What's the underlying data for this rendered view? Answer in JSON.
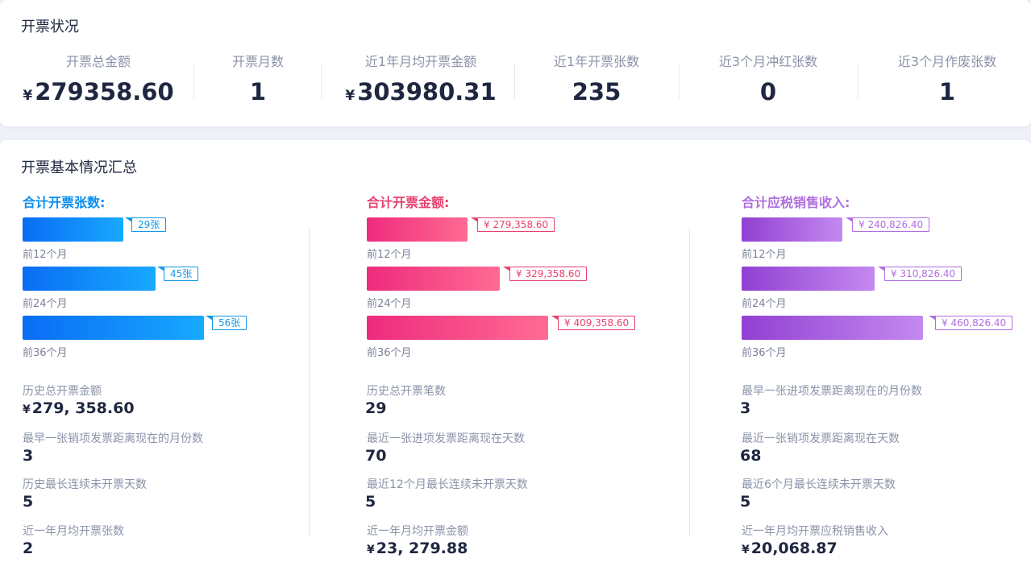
{
  "overview": {
    "title": "开票状况",
    "currency_symbol": "¥",
    "stats": [
      {
        "label": "开票总金额",
        "value": "279358.60",
        "currency": true
      },
      {
        "label": "开票月数",
        "value": "1",
        "currency": false
      },
      {
        "label": "近1年月均开票金额",
        "value": "303980.31",
        "currency": true
      },
      {
        "label": "近1年开票张数",
        "value": "235",
        "currency": false
      },
      {
        "label": "近3个月冲红张数",
        "value": "0",
        "currency": false
      },
      {
        "label": "近3个月作废张数",
        "value": "1",
        "currency": false
      }
    ]
  },
  "summary": {
    "title": "开票基本情况汇总",
    "columns": [
      {
        "heading": "合计开票张数:",
        "heading_color": "#0a8ef0",
        "bars": [
          {
            "period": "前12个月",
            "tag": "29张",
            "value": 29
          },
          {
            "period": "前24个月",
            "tag": "45张",
            "value": 45
          },
          {
            "period": "前36个月",
            "tag": "56张",
            "value": 56
          }
        ],
        "metrics": [
          {
            "label": "历史总开票金额",
            "value": "279, 358.60",
            "currency": true
          },
          {
            "label": "最早一张销项发票距离现在的月份数",
            "value": "3",
            "currency": false
          },
          {
            "label": "历史最长连续未开票天数",
            "value": "5",
            "currency": false
          },
          {
            "label": "近一年月均开票张数",
            "value": "2",
            "currency": false
          }
        ]
      },
      {
        "heading": "合计开票金额:",
        "heading_color": "#e8416f",
        "bars": [
          {
            "period": "前12个月",
            "tag": "¥ 279,358.60",
            "value": 279358.6
          },
          {
            "period": "前24个月",
            "tag": "¥ 329,358.60",
            "value": 329358.6
          },
          {
            "period": "前36个月",
            "tag": "¥ 409,358.60",
            "value": 409358.6
          }
        ],
        "metrics": [
          {
            "label": "历史总开票笔数",
            "value": "29",
            "currency": false
          },
          {
            "label": "最近一张进项发票距离现在天数",
            "value": "70",
            "currency": false
          },
          {
            "label": "最近12个月最长连续未开票天数",
            "value": "5",
            "currency": false
          },
          {
            "label": "近一年月均开票金额",
            "value": "23, 279.88",
            "currency": true
          }
        ]
      },
      {
        "heading": "合计应税销售收入:",
        "heading_color": "#b06ee0",
        "bars": [
          {
            "period": "前12个月",
            "tag": "¥ 240,826.40",
            "value": 240826.4
          },
          {
            "period": "前24个月",
            "tag": "¥ 310,826.40",
            "value": 310826.4
          },
          {
            "period": "前36个月",
            "tag": "¥ 460,826.40",
            "value": 460826.4
          }
        ],
        "metrics": [
          {
            "label": "最早一张进项发票距离现在的月份数",
            "value": "3",
            "currency": false
          },
          {
            "label": "最近一张销项发票距离现在天数",
            "value": "68",
            "currency": false
          },
          {
            "label": "最近6个月最长连续未开票天数",
            "value": "5",
            "currency": false
          },
          {
            "label": "近一年月均开票应税销售收入",
            "value": "20,068.87",
            "currency": true
          }
        ]
      }
    ]
  }
}
